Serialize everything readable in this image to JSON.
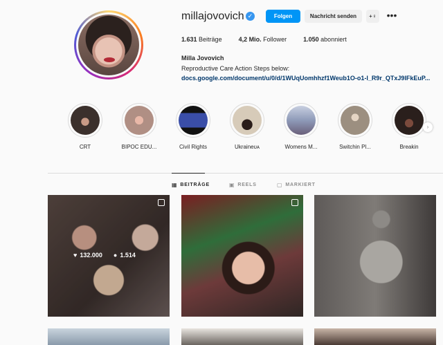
{
  "profile": {
    "username": "millajovovich",
    "verified_glyph": "✓",
    "follow_label": "Folgen",
    "message_label": "Nachricht senden",
    "adduser_glyph": "+♀",
    "more_glyph": "•••",
    "posts_count": "1.631",
    "posts_label": "Beiträge",
    "followers_count": "4,2 Mio.",
    "followers_label": "Follower",
    "following_count": "1.050",
    "following_label": "abonniert",
    "full_name": "Milla Jovovich",
    "bio": "Reproductive Care Action Steps below:",
    "link": "docs.google.com/document/u/0/d/1WUqUomhhzf1Weub1O-o1-l_R9r_QTxJ9lFkEuP..."
  },
  "highlights": [
    {
      "label": "CRT",
      "color": "#3b302c"
    },
    {
      "label": "BIPOC EDU...",
      "color": "#b08f84"
    },
    {
      "label": "Civil Rights",
      "color": "#1c2a5e"
    },
    {
      "label": "Ukraineᴜᴀ",
      "color": "#d7cbb9"
    },
    {
      "label": "Womens M...",
      "color": "#8e9ab8"
    },
    {
      "label": "Switchin Pl...",
      "color": "#9c8f80"
    },
    {
      "label": "Breakin",
      "color": "#2a1f1c"
    }
  ],
  "tabs": [
    {
      "label": "BEITRÄGE",
      "icon": "▦"
    },
    {
      "label": "REELS",
      "icon": "▣"
    },
    {
      "label": "MARKIERT",
      "icon": "▢"
    }
  ],
  "hovered_post": {
    "likes": "132.000",
    "comments": "1.514",
    "like_glyph": "♥",
    "comment_glyph": "●"
  },
  "icons": {
    "next_arrow": "›"
  },
  "colors": {
    "accent": "#0095f6",
    "link": "#00376b"
  }
}
